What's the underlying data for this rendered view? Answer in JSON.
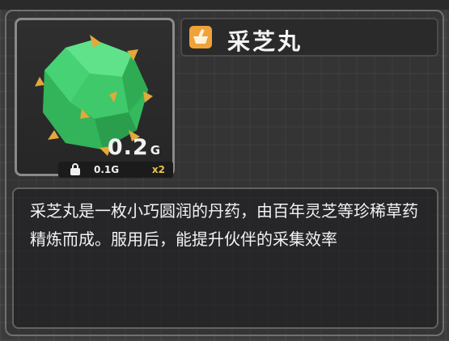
{
  "item": {
    "name": "采芝丸",
    "weight_value": "0.2",
    "weight_unit": "G",
    "unit_weight": "0.1G",
    "quantity": "x2",
    "description": "采芝丸是一枚小巧圆润的丹药，由百年灵芝等珍稀草药精炼而成。服用后，能提升伙伴的采集效率"
  },
  "icons": {
    "title_icon": "mortar-bowl-icon",
    "weight_icon": "weight-icon",
    "item_image": "green-pill-gem-icon"
  },
  "colors": {
    "gem_green": "#3fc96a",
    "gold_spikes": "#e2a93a",
    "title_icon_bg": "#f0a23a",
    "quantity_text": "#e8c34a"
  }
}
